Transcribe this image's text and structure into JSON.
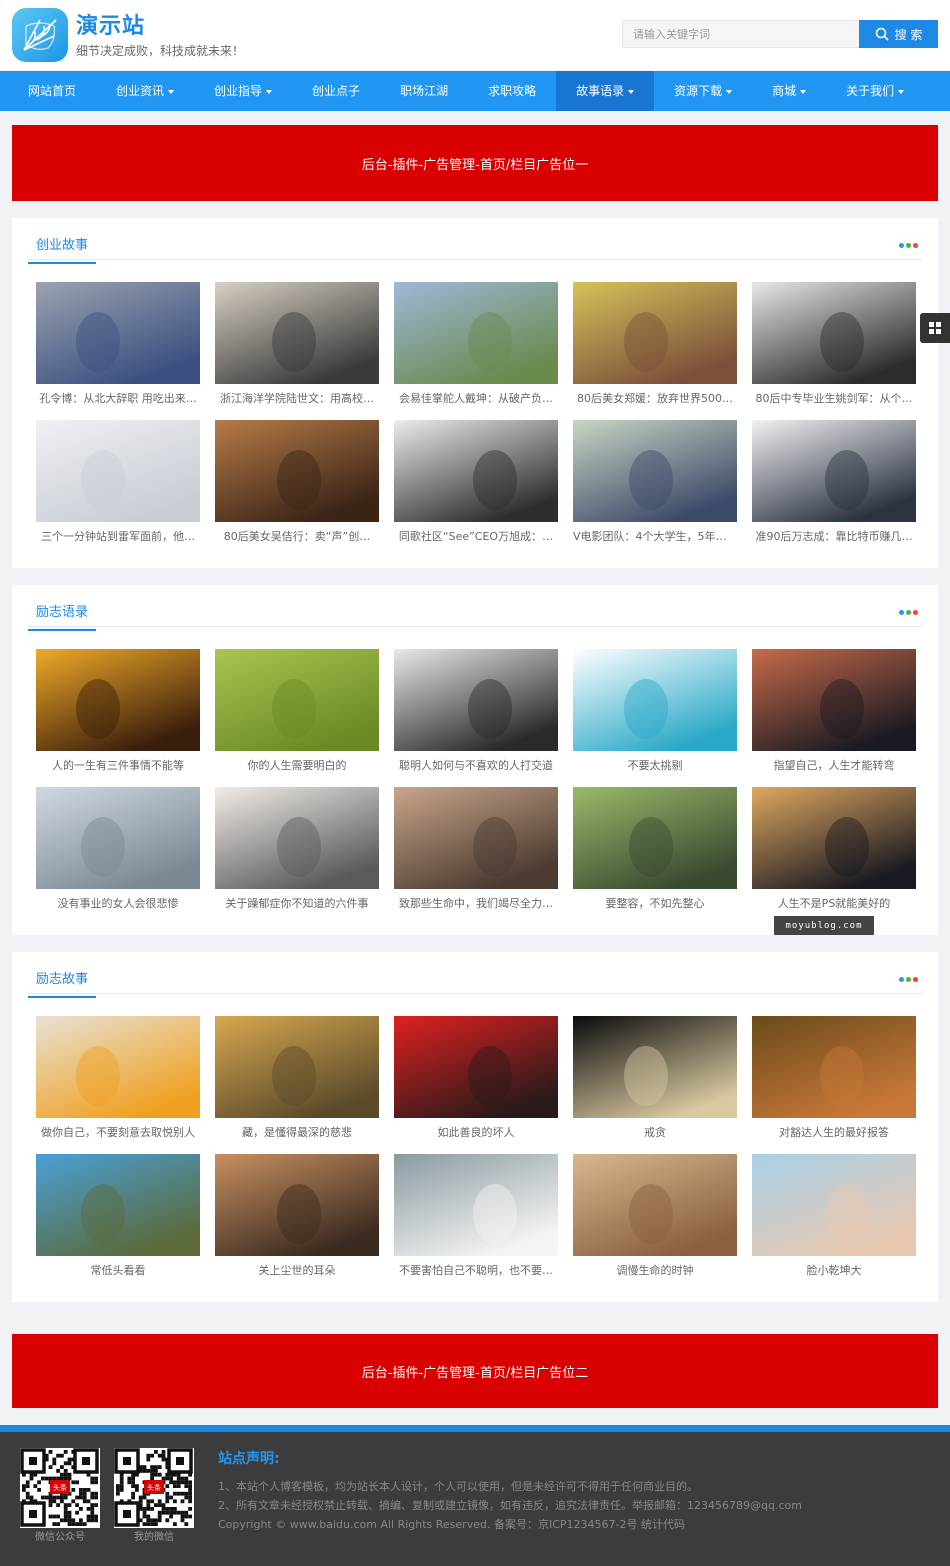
{
  "header": {
    "site_name": "演示站",
    "slogan": "细节决定成败，科技成就未来！",
    "search_placeholder": "请输入关键字词",
    "search_button": "搜 索"
  },
  "nav": [
    {
      "label": "网站首页",
      "dropdown": false,
      "active": false
    },
    {
      "label": "创业资讯",
      "dropdown": true,
      "active": false
    },
    {
      "label": "创业指导",
      "dropdown": true,
      "active": false
    },
    {
      "label": "创业点子",
      "dropdown": false,
      "active": false
    },
    {
      "label": "职场江湖",
      "dropdown": false,
      "active": false
    },
    {
      "label": "求职攻略",
      "dropdown": false,
      "active": false
    },
    {
      "label": "故事语录",
      "dropdown": true,
      "active": true
    },
    {
      "label": "资源下载",
      "dropdown": true,
      "active": false
    },
    {
      "label": "商城",
      "dropdown": true,
      "active": false
    },
    {
      "label": "关于我们",
      "dropdown": true,
      "active": false
    }
  ],
  "ads": {
    "top": "后台-插件-广告管理-首页/栏目广告位一",
    "bottom": "后台-插件-广告管理-首页/栏目广告位二"
  },
  "sections": [
    {
      "title": "创业故事",
      "items": [
        {
          "caption": "孔令博：从北大辞职 用吃出来…",
          "colors": [
            "#9aa3b0",
            "#3b4f80"
          ]
        },
        {
          "caption": "浙江海洋学院陆世文：用高校…",
          "colors": [
            "#d8d0c3",
            "#3a3a3a"
          ]
        },
        {
          "caption": "会易佳掌舵人戴坤：从破产负…",
          "colors": [
            "#9fb8d8",
            "#6a8a4e"
          ]
        },
        {
          "caption": "80后美女郑媛：放弃世界500…",
          "colors": [
            "#d6c25a",
            "#7b4f3a"
          ]
        },
        {
          "caption": "80后中专毕业生姚剑军：从个…",
          "colors": [
            "#e8e8e8",
            "#2c2c2c"
          ]
        },
        {
          "caption": "三个一分钟站到雷军面前，他…",
          "colors": [
            "#eef1f4",
            "#c8cdd4"
          ]
        },
        {
          "caption": "80后美女吴佶行：卖“声”创…",
          "colors": [
            "#b77b48",
            "#3a2416"
          ]
        },
        {
          "caption": "同歌社区“See”CEO万旭成：…",
          "colors": [
            "#ececec",
            "#2e2e2e"
          ]
        },
        {
          "caption": "V电影团队：4个大学生，5年创…",
          "colors": [
            "#c9d6c4",
            "#3c4a6a"
          ]
        },
        {
          "caption": "准90后万志成：靠比特币赚几…",
          "colors": [
            "#f1f1f3",
            "#2b3340"
          ]
        }
      ]
    },
    {
      "title": "励志语录",
      "items": [
        {
          "caption": "人的一生有三件事情不能等",
          "colors": [
            "#f1a928",
            "#3a1e0c"
          ]
        },
        {
          "caption": "你的人生需要明白的",
          "colors": [
            "#aac552",
            "#6a8a24"
          ]
        },
        {
          "caption": "聪明人如何与不喜欢的人打交道",
          "colors": [
            "#e9e9e9",
            "#2a2a2a"
          ]
        },
        {
          "caption": "不要太挑剔",
          "colors": [
            "#ffffff",
            "#2aa8c8"
          ]
        },
        {
          "caption": "指望自己，人生才能转弯",
          "colors": [
            "#c86a4a",
            "#1a1a22"
          ]
        },
        {
          "caption": "没有事业的女人会很悲惨",
          "colors": [
            "#cfd9e1",
            "#7b8894"
          ]
        },
        {
          "caption": "关于躁郁症你不知道的六件事",
          "colors": [
            "#f3ede8",
            "#5a5a5a"
          ]
        },
        {
          "caption": "致那些生命中，我们竭尽全力…",
          "colors": [
            "#c9a58a",
            "#4a3a30"
          ]
        },
        {
          "caption": "要整容，不如先整心",
          "colors": [
            "#9aba6a",
            "#3a4a30"
          ]
        },
        {
          "caption": "人生不是PS就能美好的",
          "colors": [
            "#e0a860",
            "#1a1a22"
          ]
        }
      ]
    },
    {
      "title": "励志故事",
      "items": [
        {
          "caption": "做你自己，不要刻意去取悦别人",
          "colors": [
            "#e7e2d5",
            "#f0a020"
          ]
        },
        {
          "caption": "藏，是懂得最深的慈悲",
          "colors": [
            "#d8a850",
            "#5a4a2a"
          ]
        },
        {
          "caption": "如此善良的坏人",
          "colors": [
            "#e02020",
            "#2a1a1a"
          ]
        },
        {
          "caption": "戒贪",
          "colors": [
            "#0a0a0a",
            "#d8c8a0"
          ]
        },
        {
          "caption": "对豁达人生的最好报答",
          "colors": [
            "#6a4a1a",
            "#c87838"
          ]
        },
        {
          "caption": "常低头看看",
          "colors": [
            "#4aa0d8",
            "#5a6a3a"
          ]
        },
        {
          "caption": "关上尘世的耳朵",
          "colors": [
            "#c89060",
            "#3a2a20"
          ]
        },
        {
          "caption": "不要害怕自己不聪明，也不要…",
          "colors": [
            "#8a9aa0",
            "#f4f4f4"
          ]
        },
        {
          "caption": "调慢生命的时钟",
          "colors": [
            "#d8b890",
            "#8a6040"
          ]
        },
        {
          "caption": "脸小乾坤大",
          "colors": [
            "#a8d0e8",
            "#e8c8b0"
          ]
        }
      ]
    }
  ],
  "watermark": "moyublog.com",
  "footer": {
    "qr_labels": [
      "微信公众号",
      "我的微信"
    ],
    "qr_badge": "头条",
    "title": "站点声明:",
    "lines": [
      "1、本站个人博客模板，均为站长本人设计，个人可以使用，但是未经许可不得用于任何商业目的。",
      "2、所有文章未经授权禁止转载、摘编、复制或建立镜像，如有违反，追究法律责任。举报邮箱：123456789@qq.com",
      "Copyright © www.baidu.com All Rights Reserved. 备案号：京ICP1234567-2号 统计代码"
    ]
  },
  "colors": {
    "brand": "#1e88e5",
    "nav": "#2196f3",
    "nav_active": "#1976d2",
    "ad": "#d80000",
    "footer": "#3c3c3c",
    "dots": [
      "#2196f3",
      "#4caf50",
      "#f44336"
    ]
  }
}
